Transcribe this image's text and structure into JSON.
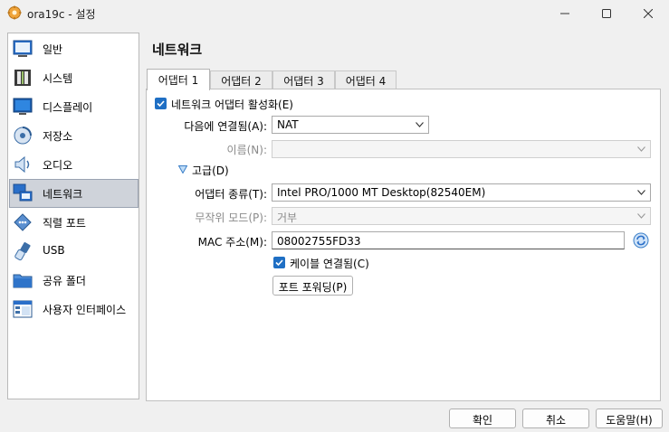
{
  "window": {
    "title": "ora19c - 설정",
    "icon": "virtualbox-gear-icon"
  },
  "sidebar": {
    "items": [
      {
        "label": "일반",
        "icon": "monitor-icon"
      },
      {
        "label": "시스템",
        "icon": "chip-icon"
      },
      {
        "label": "디스플레이",
        "icon": "display-icon"
      },
      {
        "label": "저장소",
        "icon": "disk-icon"
      },
      {
        "label": "오디오",
        "icon": "speaker-icon"
      },
      {
        "label": "네트워크",
        "icon": "network-icon",
        "selected": true
      },
      {
        "label": "직렬 포트",
        "icon": "serial-port-icon"
      },
      {
        "label": "USB",
        "icon": "usb-icon"
      },
      {
        "label": "공유 폴더",
        "icon": "folder-icon"
      },
      {
        "label": "사용자 인터페이스",
        "icon": "ui-icon"
      }
    ]
  },
  "page": {
    "title": "네트워크"
  },
  "tabs": [
    {
      "label": "어댑터 1",
      "active": true
    },
    {
      "label": "어댑터 2"
    },
    {
      "label": "어댑터 3"
    },
    {
      "label": "어댑터 4"
    }
  ],
  "adapter": {
    "enable_label": "네트워크 어댑터 활성화(E)",
    "enable_checked": true,
    "attached_label": "다음에 연결됨(A):",
    "attached_value": "NAT",
    "name_label": "이름(N):",
    "name_value": "",
    "advanced_label": "고급(D)",
    "adapter_type_label": "어댑터 종류(T):",
    "adapter_type_value": "Intel PRO/1000 MT Desktop(82540EM)",
    "promisc_label": "무작위 모드(P):",
    "promisc_value": "거부",
    "mac_label": "MAC 주소(M):",
    "mac_value": "08002755FD33",
    "cable_label": "케이블 연결됨(C)",
    "cable_checked": true,
    "port_forward_label": "포트 포워딩(P)"
  },
  "footer": {
    "ok_label": "확인",
    "cancel_label": "취소",
    "help_label": "도움말(H)"
  },
  "colors": {
    "accent": "#1f6fc4",
    "selected_bg": "#cfd3da"
  }
}
